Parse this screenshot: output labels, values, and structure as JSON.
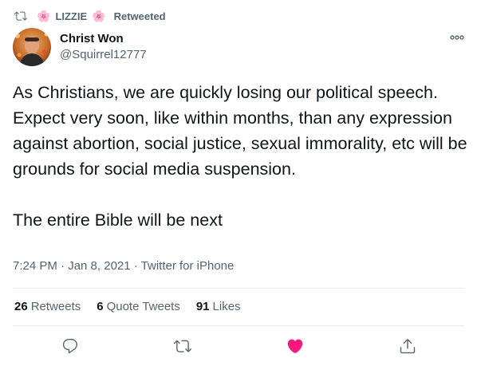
{
  "retweet_header": {
    "flower_left": "🌸",
    "name": "LIZZIE",
    "flower_right": "🌸",
    "suffix": "Retweeted"
  },
  "author": {
    "display_name": "Christ Won",
    "handle": "@Squirrel12777"
  },
  "tweet": {
    "text": "As Christians, we are quickly losing our political speech. Expect very soon, like within months, than any expression against abortion, social justice, sexual immorality, etc will be grounds for social media suspension.\n\nThe entire Bible will be next",
    "meta": "7:24 PM · Jan 8, 2021 · Twitter for iPhone"
  },
  "stats": {
    "retweets_count": "26",
    "retweets_label": "Retweets",
    "quotes_count": "6",
    "quotes_label": "Quote Tweets",
    "likes_count": "91",
    "likes_label": "Likes"
  },
  "colors": {
    "text_primary": "#0f1419",
    "text_secondary": "#536471",
    "like_active": "#f91880",
    "divider": "#e6ecf0"
  },
  "icons": {
    "retweet_header": "retweet-icon",
    "more": "more-horizontal-icon",
    "reply": "reply-icon",
    "retweet": "retweet-icon",
    "like": "heart-filled-icon",
    "share": "share-icon"
  }
}
